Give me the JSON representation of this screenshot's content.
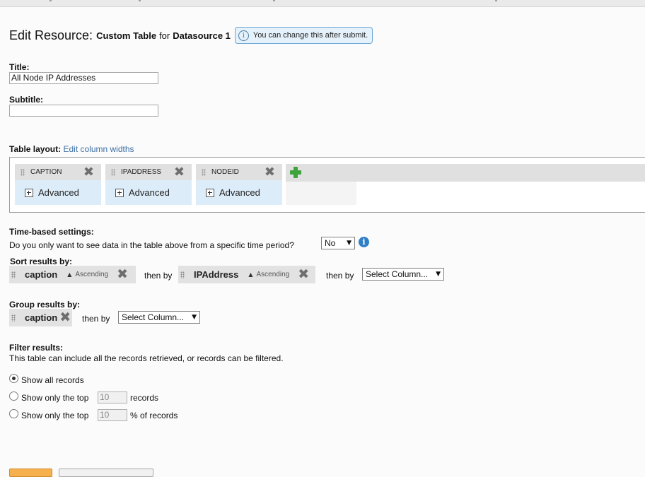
{
  "page": {
    "heading_prefix": "Edit Resource:",
    "resource_type": "Custom Table",
    "heading_for": "for",
    "datasource": "Datasource 1",
    "hint": "You can change this after submit."
  },
  "title": {
    "label": "Title:",
    "value": "All Node IP Addresses"
  },
  "subtitle": {
    "label": "Subtitle:",
    "value": ""
  },
  "table_layout": {
    "label": "Table layout:",
    "edit_link": "Edit column widths",
    "columns": [
      {
        "name": "CAPTION",
        "advanced": "Advanced"
      },
      {
        "name": "IPADDRESS",
        "advanced": "Advanced"
      },
      {
        "name": "NODEID",
        "advanced": "Advanced"
      }
    ]
  },
  "time_settings": {
    "label": "Time-based settings:",
    "question": "Do you only want to see data in the table above from a specific time period?",
    "selected": "No"
  },
  "sort": {
    "label": "Sort results by:",
    "first": {
      "name": "caption",
      "direction": "Ascending"
    },
    "then_by_1": "then by",
    "second": {
      "name": "IPAddress",
      "direction": "Ascending"
    },
    "then_by_2": "then by",
    "select_placeholder": "Select Column..."
  },
  "group": {
    "label": "Group results by:",
    "first": {
      "name": "caption"
    },
    "then_by": "then by",
    "select_placeholder": "Select Column..."
  },
  "filter": {
    "label": "Filter results:",
    "description": "This table can include all the records retrieved, or records can be filtered.",
    "options": [
      {
        "label": "Show all records",
        "checked": true
      },
      {
        "prefix": "Show only the top",
        "value": "10",
        "suffix": "records",
        "checked": false
      },
      {
        "prefix": "Show only the top",
        "value": "10",
        "suffix": "% of records",
        "checked": false
      }
    ]
  },
  "icons": [
    "info-icon",
    "drag-grip-icon",
    "remove-x-icon",
    "expand-plus-icon",
    "add-column-icon",
    "dropdown-arrow-icon"
  ],
  "colors": {
    "accent_link": "#3c6fa6",
    "hint_bg": "#e6f2fb",
    "add_green": "#3da33d",
    "info_blue": "#2f7fc7",
    "primary_button": "#f6b04e"
  }
}
